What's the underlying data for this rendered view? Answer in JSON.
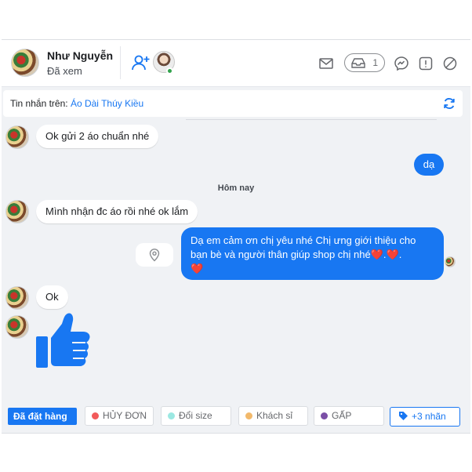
{
  "header": {
    "contact_name": "Như Nguyễn",
    "seen_status": "Đã xem",
    "pill_count": "1"
  },
  "infobar": {
    "label": "Tin nhắn trên:",
    "page_name": "Áo Dài Thúy Kiều"
  },
  "messages": [
    {
      "dir": "in",
      "text": "Ok gửi 2 áo chuẩn nhé"
    },
    {
      "dir": "out",
      "text": "dạ"
    },
    {
      "dir": "in",
      "text": "Mình nhận đc áo rồi nhé ok lắm"
    },
    {
      "dir": "out",
      "text_line1": "Dạ em cảm ơn chị yêu nhé Chị ưng giới thiệu cho",
      "text_line2": "bạn bè và người thân giúp shop chị nhé",
      "emoji": "❤️"
    },
    {
      "dir": "in",
      "text": "Ok"
    },
    {
      "dir": "in",
      "sticker": "thumbs-up-like"
    }
  ],
  "date_separator": "Hôm nay",
  "tags": {
    "active": "Đã đặt hàng",
    "items": [
      {
        "label": "HỦY ĐƠN",
        "color": "#f25a5a"
      },
      {
        "label": "Đổi size",
        "color": "#9be8e2"
      },
      {
        "label": "Khách sỉ",
        "color": "#f2b96b"
      },
      {
        "label": "GẤP",
        "color": "#7b4fa6"
      }
    ],
    "more": "+3 nhãn"
  },
  "colors": {
    "accent": "#1877f2",
    "heart": "#e41e3f",
    "background": "#f0f2f5"
  }
}
